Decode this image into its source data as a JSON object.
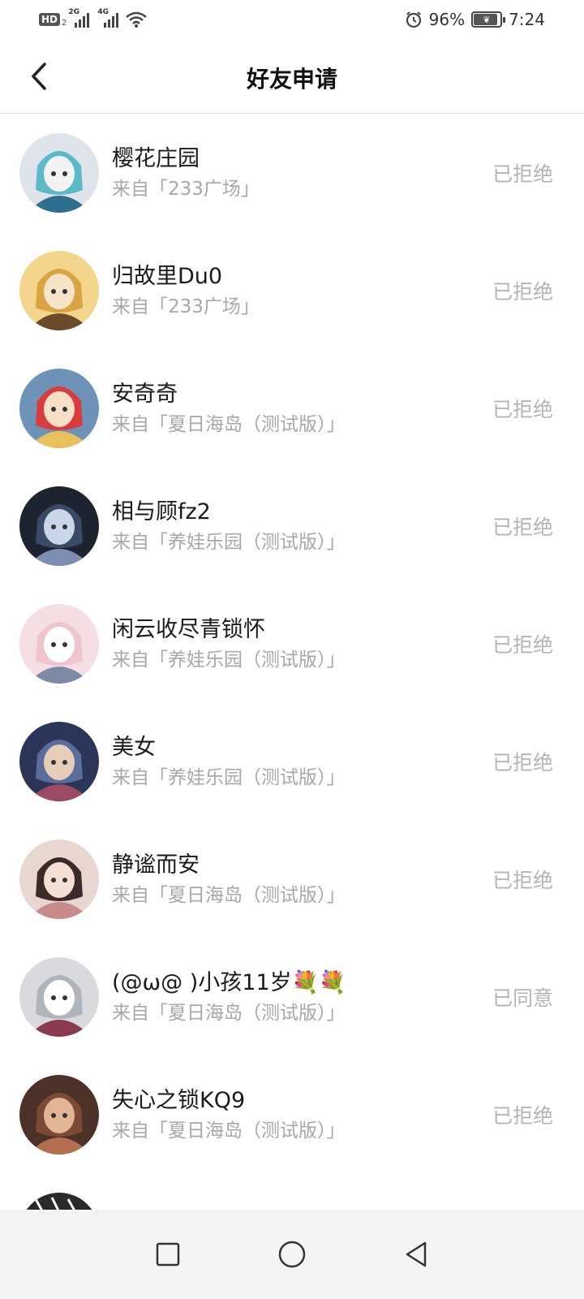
{
  "status_bar": {
    "hd_label": "HD",
    "hd_sub": "2",
    "sim1_network": "2G",
    "sim2_network": "4G",
    "battery_percent": "96%",
    "battery_level": 0.96,
    "time": "7:24"
  },
  "header": {
    "title": "好友申请",
    "back_icon": "chevron-left-icon"
  },
  "requests": [
    {
      "name": "樱花庄园",
      "source": "来自「233广场」",
      "status": "已拒绝"
    },
    {
      "name": "归故里Du0",
      "source": "来自「233广场」",
      "status": "已拒绝"
    },
    {
      "name": "安奇奇",
      "source": "来自「夏日海岛（测试版）」",
      "status": "已拒绝"
    },
    {
      "name": "相与顾fz2",
      "source": "来自「养娃乐园（测试版）」",
      "status": "已拒绝"
    },
    {
      "name": "闲云收尽青锁怀",
      "source": "来自「养娃乐园（测试版）」",
      "status": "已拒绝"
    },
    {
      "name": "美女",
      "source": "来自「养娃乐园（测试版）」",
      "status": "已拒绝"
    },
    {
      "name": "静谧而安",
      "source": "来自「夏日海岛（测试版）」",
      "status": "已拒绝"
    },
    {
      "name": "(@ω@ )小孩11岁💐💐",
      "source": "来自「夏日海岛（测试版）」",
      "status": "已同意"
    },
    {
      "name": "失心之锁KQ9",
      "source": "来自「夏日海岛（测试版）」",
      "status": "已拒绝"
    }
  ],
  "nav_bar": {
    "recent_icon": "square-icon",
    "home_icon": "circle-icon",
    "back_icon": "triangle-back-icon"
  }
}
